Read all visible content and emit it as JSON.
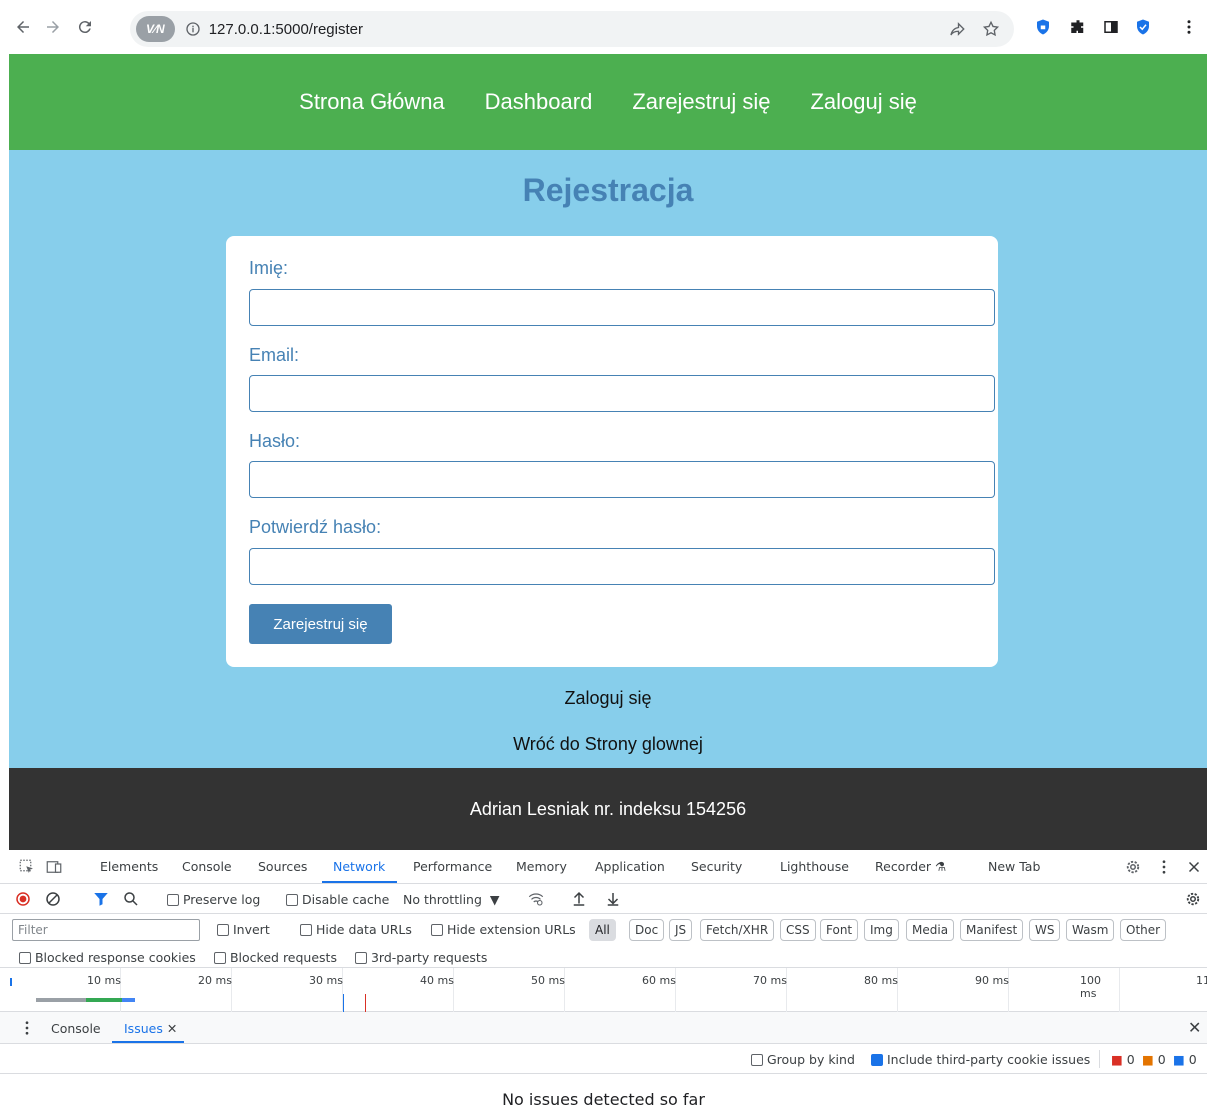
{
  "browser": {
    "url": "127.0.0.1:5000/register",
    "vpn_label": "V⁄N"
  },
  "site": {
    "nav": [
      "Strona Główna",
      "Dashboard",
      "Zarejestruj się",
      "Zaloguj się"
    ],
    "title": "Rejestracja",
    "form": {
      "name_label": "Imię:",
      "email_label": "Email:",
      "password_label": "Hasło:",
      "confirm_label": "Potwierdź hasło:",
      "submit_label": "Zarejestruj się"
    },
    "login_link": "Zaloguj się",
    "home_link": "Wróć do Strony glownej",
    "footer": "Adrian Lesniak nr. indeksu 154256"
  },
  "devtools": {
    "tabs": [
      "Elements",
      "Console",
      "Sources",
      "Network",
      "Performance",
      "Memory",
      "Application",
      "Security",
      "Lighthouse",
      "Recorder",
      "New Tab"
    ],
    "active_tab": "Network",
    "preserve_log": "Preserve log",
    "disable_cache": "Disable cache",
    "throttling": "No throttling",
    "filter_placeholder": "Filter",
    "invert": "Invert",
    "hide_data_urls": "Hide data URLs",
    "hide_extension_urls": "Hide extension URLs",
    "type_filters": [
      "All",
      "Doc",
      "JS",
      "Fetch/XHR",
      "CSS",
      "Font",
      "Img",
      "Media",
      "Manifest",
      "WS",
      "Wasm",
      "Other"
    ],
    "blocked_cookies": "Blocked response cookies",
    "blocked_requests": "Blocked requests",
    "third_party": "3rd-party requests",
    "timeline_ticks": [
      "10 ms",
      "20 ms",
      "30 ms",
      "40 ms",
      "50 ms",
      "60 ms",
      "70 ms",
      "80 ms",
      "90 ms",
      "100 ms",
      "11"
    ],
    "drawer_tabs": [
      "Console",
      "Issues"
    ],
    "group_by_kind": "Group by kind",
    "include_third_party": "Include third-party cookie issues",
    "error_count": "0",
    "warning_count": "0",
    "info_count": "0",
    "no_issues": "No issues detected so far"
  }
}
